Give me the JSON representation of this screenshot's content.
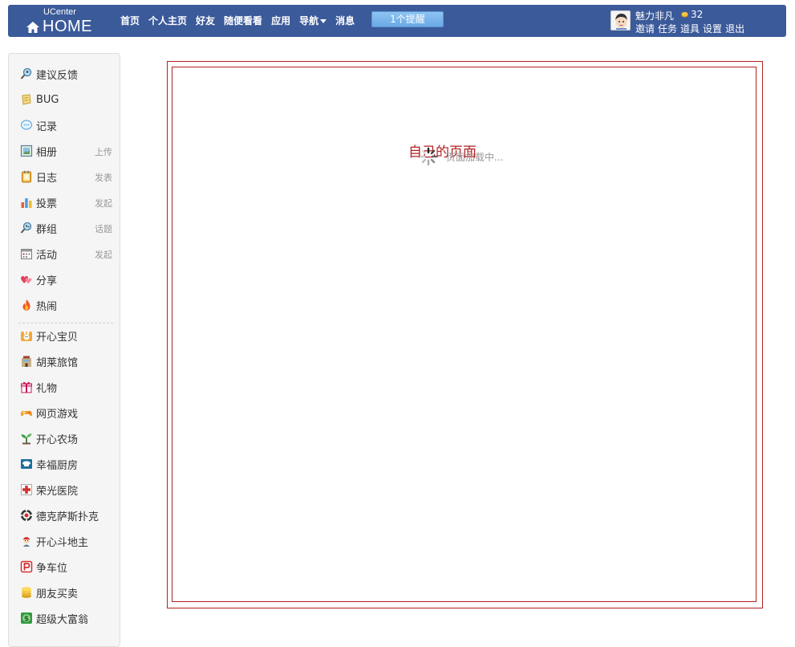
{
  "header": {
    "logo_top": "UCenter",
    "logo_main": "HOME",
    "nav": [
      {
        "label": "首页"
      },
      {
        "label": "个人主页"
      },
      {
        "label": "好友"
      },
      {
        "label": "随便看看"
      },
      {
        "label": "应用"
      },
      {
        "label": "导航"
      },
      {
        "label": "消息"
      }
    ],
    "notify_label": "1个提醒",
    "user": {
      "name": "魅力非凡",
      "coins": "32",
      "links": [
        "邀请",
        "任务",
        "道具",
        "设置",
        "退出"
      ]
    },
    "colors": {
      "bar": "#3b5a9a",
      "notify": "#7fb7ee"
    }
  },
  "sidebar": {
    "items": [
      {
        "label": "建议反馈",
        "icon": "magnifier-people-icon",
        "action": ""
      },
      {
        "label": "BUG",
        "icon": "scroll-icon",
        "action": ""
      },
      {
        "label": "记录",
        "icon": "speech-bubble-icon",
        "action": ""
      },
      {
        "label": "相册",
        "icon": "photo-album-icon",
        "action": "上传"
      },
      {
        "label": "日志",
        "icon": "notebook-icon",
        "action": "发表"
      },
      {
        "label": "投票",
        "icon": "bar-chart-icon",
        "action": "发起"
      },
      {
        "label": "群组",
        "icon": "group-icon",
        "action": "话题"
      },
      {
        "label": "活动",
        "icon": "calendar-icon",
        "action": "发起"
      },
      {
        "label": "分享",
        "icon": "hearts-icon",
        "action": ""
      },
      {
        "label": "热闹",
        "icon": "fire-icon",
        "action": ""
      }
    ],
    "apps": [
      {
        "label": "开心宝贝",
        "icon": "bunny-icon"
      },
      {
        "label": "胡莱旅馆",
        "icon": "hotel-icon"
      },
      {
        "label": "礼物",
        "icon": "gift-icon"
      },
      {
        "label": "网页游戏",
        "icon": "game-icon"
      },
      {
        "label": "开心农场",
        "icon": "sprout-icon"
      },
      {
        "label": "幸福厨房",
        "icon": "kitchen-icon"
      },
      {
        "label": "荣光医院",
        "icon": "hospital-cross-icon"
      },
      {
        "label": "德克萨斯扑克",
        "icon": "poker-chip-icon"
      },
      {
        "label": "开心斗地主",
        "icon": "cards-icon"
      },
      {
        "label": "争车位",
        "icon": "parking-icon"
      },
      {
        "label": "朋友买卖",
        "icon": "coins-icon"
      },
      {
        "label": "超级大富翁",
        "icon": "dollar-icon"
      }
    ]
  },
  "main": {
    "page_title": "自己的页面",
    "loading_text": "页面加载中...",
    "border_color": "#b22222"
  }
}
